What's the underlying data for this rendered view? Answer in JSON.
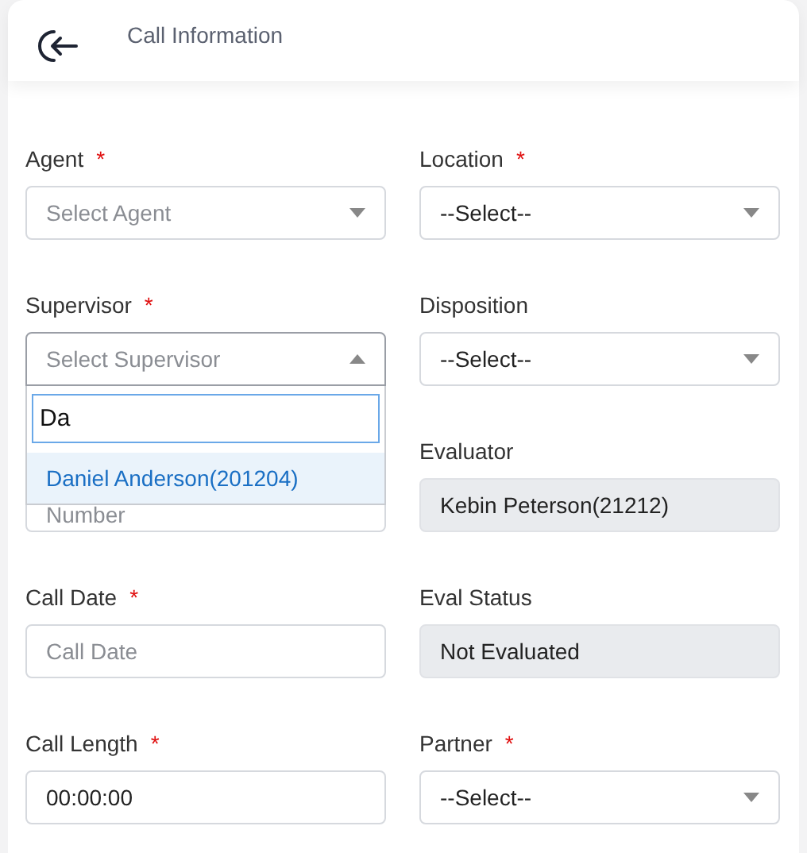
{
  "header": {
    "title": "Call Information"
  },
  "fields": [
    {
      "kind": "select",
      "label": "Agent",
      "required_mark": "*",
      "placeholder": "Select Agent",
      "open": false
    },
    {
      "kind": "select",
      "label": "Location",
      "required_mark": "*",
      "value": "--Select--",
      "open": false
    },
    {
      "kind": "select",
      "label": "Supervisor",
      "required_mark": "*",
      "placeholder": "Select Supervisor",
      "open": true,
      "dropdown": {
        "search": "Da",
        "options": [
          {
            "label": "Daniel Anderson(201204)",
            "selected": true
          }
        ]
      }
    },
    {
      "kind": "select",
      "label": "Disposition",
      "value": "--Select--",
      "open": false
    },
    {
      "kind": "text",
      "placeholder": "Number"
    },
    {
      "kind": "readonly",
      "label": "Evaluator",
      "value": "Kebin Peterson(21212)"
    },
    {
      "kind": "text",
      "label": "Call Date",
      "required_mark": "*",
      "placeholder": "Call Date"
    },
    {
      "kind": "readonly",
      "label": "Eval Status",
      "value": "Not Evaluated"
    },
    {
      "kind": "text",
      "label": "Call Length",
      "required_mark": "*",
      "value": "00:00:00"
    },
    {
      "kind": "select",
      "label": "Partner",
      "required_mark": "*",
      "value": "--Select--",
      "open": false
    }
  ]
}
